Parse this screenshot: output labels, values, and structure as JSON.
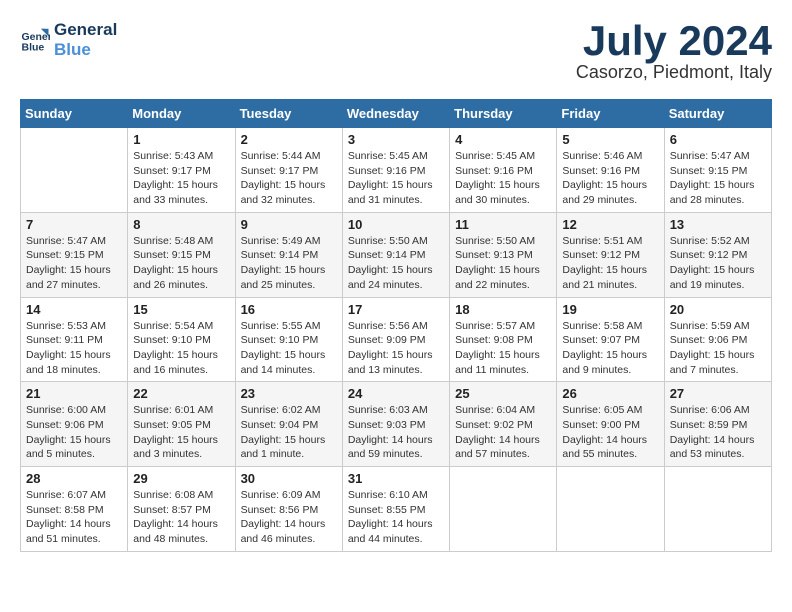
{
  "header": {
    "logo_line1": "General",
    "logo_line2": "Blue",
    "title": "July 2024",
    "subtitle": "Casorzo, Piedmont, Italy"
  },
  "calendar": {
    "days_of_week": [
      "Sunday",
      "Monday",
      "Tuesday",
      "Wednesday",
      "Thursday",
      "Friday",
      "Saturday"
    ],
    "weeks": [
      [
        {
          "num": "",
          "info": ""
        },
        {
          "num": "1",
          "info": "Sunrise: 5:43 AM\nSunset: 9:17 PM\nDaylight: 15 hours\nand 33 minutes."
        },
        {
          "num": "2",
          "info": "Sunrise: 5:44 AM\nSunset: 9:17 PM\nDaylight: 15 hours\nand 32 minutes."
        },
        {
          "num": "3",
          "info": "Sunrise: 5:45 AM\nSunset: 9:16 PM\nDaylight: 15 hours\nand 31 minutes."
        },
        {
          "num": "4",
          "info": "Sunrise: 5:45 AM\nSunset: 9:16 PM\nDaylight: 15 hours\nand 30 minutes."
        },
        {
          "num": "5",
          "info": "Sunrise: 5:46 AM\nSunset: 9:16 PM\nDaylight: 15 hours\nand 29 minutes."
        },
        {
          "num": "6",
          "info": "Sunrise: 5:47 AM\nSunset: 9:15 PM\nDaylight: 15 hours\nand 28 minutes."
        }
      ],
      [
        {
          "num": "7",
          "info": "Sunrise: 5:47 AM\nSunset: 9:15 PM\nDaylight: 15 hours\nand 27 minutes."
        },
        {
          "num": "8",
          "info": "Sunrise: 5:48 AM\nSunset: 9:15 PM\nDaylight: 15 hours\nand 26 minutes."
        },
        {
          "num": "9",
          "info": "Sunrise: 5:49 AM\nSunset: 9:14 PM\nDaylight: 15 hours\nand 25 minutes."
        },
        {
          "num": "10",
          "info": "Sunrise: 5:50 AM\nSunset: 9:14 PM\nDaylight: 15 hours\nand 24 minutes."
        },
        {
          "num": "11",
          "info": "Sunrise: 5:50 AM\nSunset: 9:13 PM\nDaylight: 15 hours\nand 22 minutes."
        },
        {
          "num": "12",
          "info": "Sunrise: 5:51 AM\nSunset: 9:12 PM\nDaylight: 15 hours\nand 21 minutes."
        },
        {
          "num": "13",
          "info": "Sunrise: 5:52 AM\nSunset: 9:12 PM\nDaylight: 15 hours\nand 19 minutes."
        }
      ],
      [
        {
          "num": "14",
          "info": "Sunrise: 5:53 AM\nSunset: 9:11 PM\nDaylight: 15 hours\nand 18 minutes."
        },
        {
          "num": "15",
          "info": "Sunrise: 5:54 AM\nSunset: 9:10 PM\nDaylight: 15 hours\nand 16 minutes."
        },
        {
          "num": "16",
          "info": "Sunrise: 5:55 AM\nSunset: 9:10 PM\nDaylight: 15 hours\nand 14 minutes."
        },
        {
          "num": "17",
          "info": "Sunrise: 5:56 AM\nSunset: 9:09 PM\nDaylight: 15 hours\nand 13 minutes."
        },
        {
          "num": "18",
          "info": "Sunrise: 5:57 AM\nSunset: 9:08 PM\nDaylight: 15 hours\nand 11 minutes."
        },
        {
          "num": "19",
          "info": "Sunrise: 5:58 AM\nSunset: 9:07 PM\nDaylight: 15 hours\nand 9 minutes."
        },
        {
          "num": "20",
          "info": "Sunrise: 5:59 AM\nSunset: 9:06 PM\nDaylight: 15 hours\nand 7 minutes."
        }
      ],
      [
        {
          "num": "21",
          "info": "Sunrise: 6:00 AM\nSunset: 9:06 PM\nDaylight: 15 hours\nand 5 minutes."
        },
        {
          "num": "22",
          "info": "Sunrise: 6:01 AM\nSunset: 9:05 PM\nDaylight: 15 hours\nand 3 minutes."
        },
        {
          "num": "23",
          "info": "Sunrise: 6:02 AM\nSunset: 9:04 PM\nDaylight: 15 hours\nand 1 minute."
        },
        {
          "num": "24",
          "info": "Sunrise: 6:03 AM\nSunset: 9:03 PM\nDaylight: 14 hours\nand 59 minutes."
        },
        {
          "num": "25",
          "info": "Sunrise: 6:04 AM\nSunset: 9:02 PM\nDaylight: 14 hours\nand 57 minutes."
        },
        {
          "num": "26",
          "info": "Sunrise: 6:05 AM\nSunset: 9:00 PM\nDaylight: 14 hours\nand 55 minutes."
        },
        {
          "num": "27",
          "info": "Sunrise: 6:06 AM\nSunset: 8:59 PM\nDaylight: 14 hours\nand 53 minutes."
        }
      ],
      [
        {
          "num": "28",
          "info": "Sunrise: 6:07 AM\nSunset: 8:58 PM\nDaylight: 14 hours\nand 51 minutes."
        },
        {
          "num": "29",
          "info": "Sunrise: 6:08 AM\nSunset: 8:57 PM\nDaylight: 14 hours\nand 48 minutes."
        },
        {
          "num": "30",
          "info": "Sunrise: 6:09 AM\nSunset: 8:56 PM\nDaylight: 14 hours\nand 46 minutes."
        },
        {
          "num": "31",
          "info": "Sunrise: 6:10 AM\nSunset: 8:55 PM\nDaylight: 14 hours\nand 44 minutes."
        },
        {
          "num": "",
          "info": ""
        },
        {
          "num": "",
          "info": ""
        },
        {
          "num": "",
          "info": ""
        }
      ]
    ]
  }
}
